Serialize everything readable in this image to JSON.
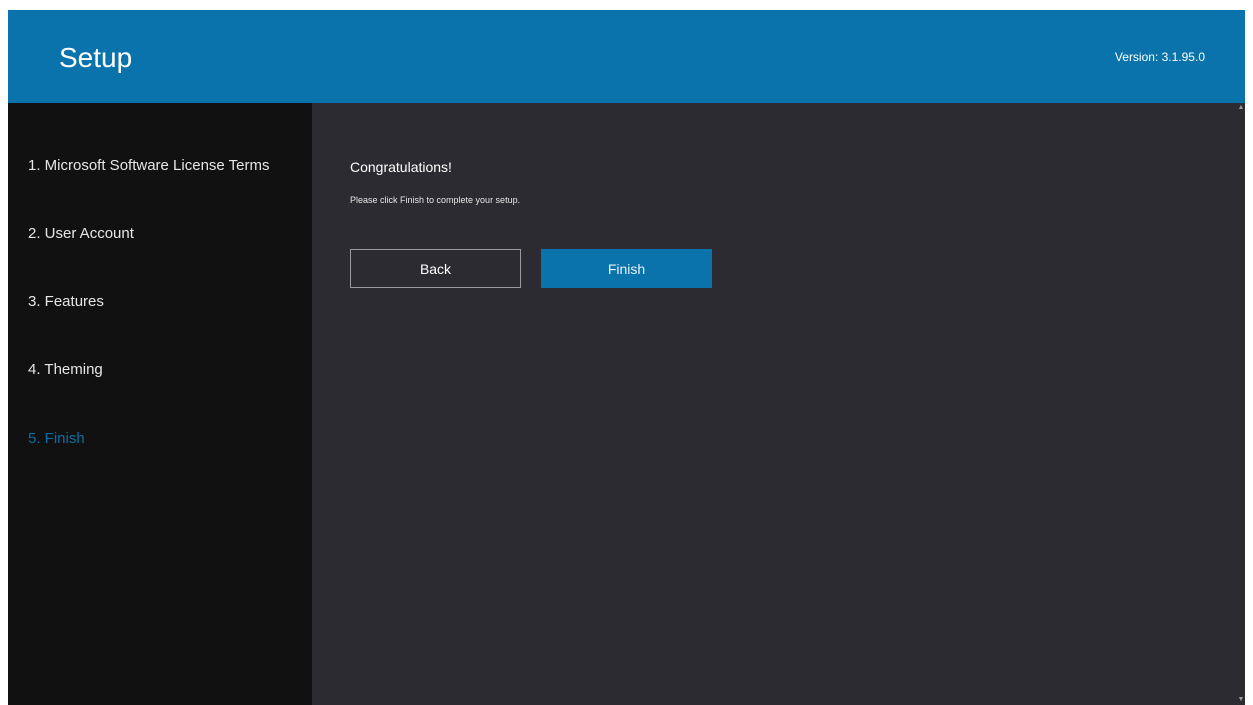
{
  "header": {
    "title": "Setup",
    "version": "Version: 3.1.95.0"
  },
  "sidebar": {
    "steps": [
      {
        "label": "1. Microsoft Software License Terms",
        "active": false
      },
      {
        "label": "2. User Account",
        "active": false
      },
      {
        "label": "3. Features",
        "active": false
      },
      {
        "label": "4. Theming",
        "active": false
      },
      {
        "label": "5. Finish",
        "active": true
      }
    ]
  },
  "main": {
    "heading": "Congratulations!",
    "description": "Please click Finish to complete your setup.",
    "back_label": "Back",
    "finish_label": "Finish"
  },
  "scrollbar": {
    "up_icon": "chevron-up-icon",
    "down_icon": "chevron-down-icon"
  },
  "colors": {
    "accent": "#0b73ac",
    "sidebar_bg": "#111111",
    "content_bg": "#2c2b31",
    "active_step": "#0b6fa3"
  }
}
